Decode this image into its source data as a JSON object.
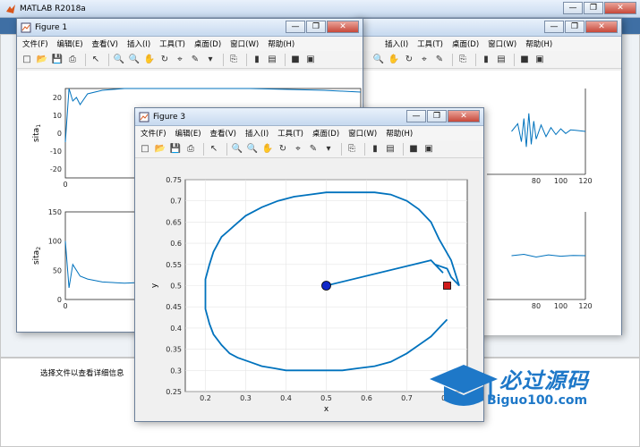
{
  "matlab": {
    "title": "MATLAB R2018a",
    "status_text": "选择文件以查看详细信息"
  },
  "figure1": {
    "title": "Figure 1",
    "menu": [
      "文件(F)",
      "编辑(E)",
      "查看(V)",
      "插入(I)",
      "工具(T)",
      "桌面(D)",
      "窗口(W)",
      "帮助(H)"
    ]
  },
  "figure3": {
    "title": "Figure 3",
    "menu": [
      "文件(F)",
      "编辑(E)",
      "查看(V)",
      "插入(I)",
      "工具(T)",
      "桌面(D)",
      "窗口(W)",
      "帮助(H)"
    ]
  },
  "figure_back": {
    "menu": [
      "插入(I)",
      "工具(T)",
      "桌面(D)",
      "窗口(W)",
      "帮助(H)"
    ]
  },
  "window_buttons": {
    "minimize": "—",
    "restore": "❐",
    "close": "✕"
  },
  "watermark": {
    "text": "必过源码",
    "url": "Biguo100.com",
    "color": "#1e78c8"
  },
  "chart_data": [
    {
      "type": "line",
      "ylabel": "sita",
      "ylabel_sub": "1",
      "xlim": [
        0,
        40
      ],
      "ylim": [
        -25,
        25
      ],
      "x_ticks": [
        0,
        20
      ],
      "y_ticks": [
        20,
        10,
        0,
        -10,
        -20
      ],
      "series": [
        {
          "x": [
            0,
            0.5,
            1,
            1.5,
            2,
            3,
            5,
            8,
            12,
            16,
            20,
            25,
            30,
            35,
            40
          ],
          "values": [
            -5,
            25,
            18,
            20,
            16,
            22,
            24,
            25,
            25,
            25,
            25,
            25,
            24.5,
            24,
            23
          ],
          "color": "#0072bd"
        }
      ]
    },
    {
      "type": "line",
      "ylabel": "sita",
      "ylabel_sub": "2",
      "xlim": [
        0,
        40
      ],
      "ylim": [
        0,
        150
      ],
      "x_ticks": [
        0,
        20
      ],
      "y_ticks": [
        150,
        100,
        50,
        0
      ],
      "series": [
        {
          "x": [
            0,
            0.5,
            1,
            2,
            3,
            5,
            8,
            12,
            16,
            20,
            25,
            30,
            32
          ],
          "values": [
            100,
            20,
            60,
            40,
            35,
            30,
            28,
            30,
            35,
            40,
            45,
            55,
            60
          ],
          "color": "#0072bd"
        }
      ]
    },
    {
      "type": "line",
      "xlabel": "x",
      "ylabel": "y",
      "xlim": [
        0.15,
        0.85
      ],
      "ylim": [
        0.25,
        0.75
      ],
      "x_ticks": [
        0.2,
        0.3,
        0.4,
        0.5,
        0.6,
        0.7,
        0.8
      ],
      "y_ticks": [
        0.75,
        0.7,
        0.65,
        0.6,
        0.55,
        0.5,
        0.45,
        0.4,
        0.35,
        0.3,
        0.25
      ],
      "center": [
        0.5,
        0.5
      ],
      "target": [
        0.8,
        0.5
      ],
      "series": [
        {
          "color": "#0072bd",
          "x": [
            0.5,
            0.76,
            0.79,
            0.77,
            0.8,
            0.81,
            0.83,
            0.81,
            0.78,
            0.76,
            0.73,
            0.7,
            0.66,
            0.62,
            0.58,
            0.54,
            0.5,
            0.46,
            0.42,
            0.38,
            0.34,
            0.3,
            0.27,
            0.24,
            0.22,
            0.21,
            0.2,
            0.2,
            0.2,
            0.21,
            0.22,
            0.24,
            0.26,
            0.28,
            0.31,
            0.34,
            0.37,
            0.4,
            0.43,
            0.46,
            0.5,
            0.54,
            0.58,
            0.62,
            0.66,
            0.7,
            0.73,
            0.76,
            0.78,
            0.8
          ],
          "values": [
            0.5,
            0.56,
            0.53,
            0.55,
            0.54,
            0.52,
            0.5,
            0.56,
            0.61,
            0.65,
            0.68,
            0.7,
            0.715,
            0.72,
            0.72,
            0.72,
            0.72,
            0.715,
            0.71,
            0.7,
            0.685,
            0.665,
            0.64,
            0.615,
            0.58,
            0.55,
            0.515,
            0.48,
            0.445,
            0.41,
            0.385,
            0.36,
            0.34,
            0.33,
            0.32,
            0.31,
            0.305,
            0.3,
            0.3,
            0.3,
            0.3,
            0.3,
            0.305,
            0.31,
            0.32,
            0.34,
            0.36,
            0.38,
            0.4,
            0.42
          ]
        }
      ]
    },
    {
      "type": "line",
      "xlim": [
        40,
        120
      ],
      "x_ticks": [
        80,
        100,
        120
      ],
      "series": [
        {
          "x": [
            60,
            65,
            68,
            70,
            72,
            74,
            76,
            78,
            80,
            84,
            88,
            92,
            96,
            100,
            104,
            108,
            112,
            116,
            120
          ],
          "values": [
            0,
            0.3,
            -0.4,
            0.5,
            -0.6,
            0.7,
            -0.5,
            0.4,
            -0.3,
            0.25,
            -0.2,
            0.15,
            -0.12,
            0.1,
            -0.08,
            0.06,
            0.04,
            0.02,
            0
          ],
          "color": "#0072bd"
        }
      ]
    },
    {
      "type": "line",
      "xlim": [
        40,
        120
      ],
      "x_ticks": [
        80,
        100,
        120
      ],
      "series": [
        {
          "x": [
            60,
            70,
            80,
            90,
            100,
            110,
            120
          ],
          "values": [
            0,
            0.05,
            -0.05,
            0.03,
            -0.02,
            0.01,
            0
          ],
          "color": "#0072bd"
        }
      ]
    }
  ]
}
